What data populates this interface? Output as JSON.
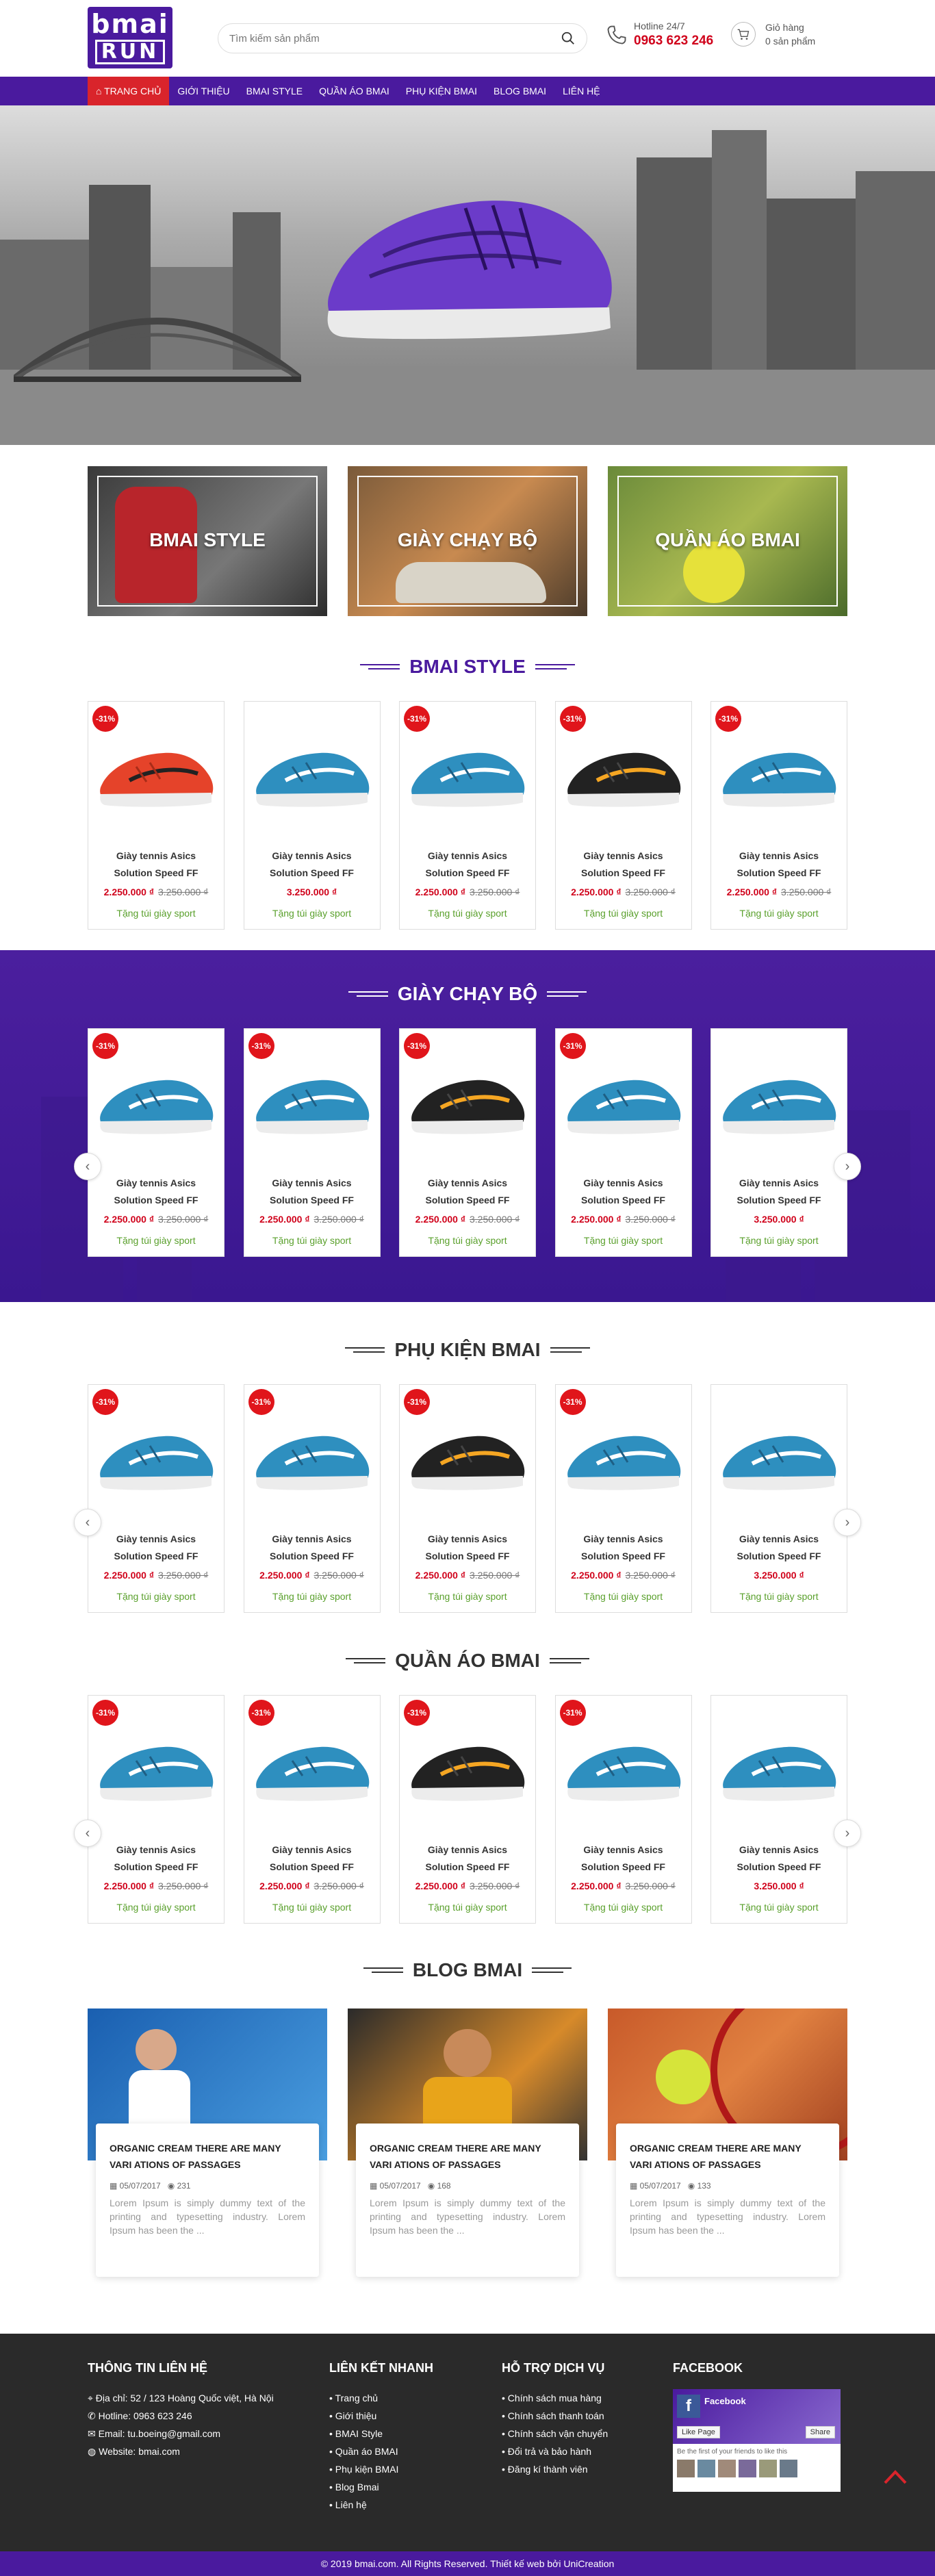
{
  "header": {
    "logo_top": "bmai",
    "logo_bottom": "RUN",
    "search_placeholder": "Tìm kiếm sản phẩm",
    "hotline_label": "Hotline 24/7",
    "hotline_number": "0963 623 246",
    "cart_label": "Giỏ hàng",
    "cart_count": "0 sản phẩm"
  },
  "nav": [
    "Trang chủ",
    "Giới thiệu",
    "BMAI Style",
    "Quần áo BMAI",
    "Phụ kiện BMAI",
    "Blog BMAI",
    "Liên hệ"
  ],
  "categories": [
    "BMAI STYLE",
    "GIÀY CHẠY BỘ",
    "QUẦN ÁO BMAI"
  ],
  "sections": [
    {
      "title": "BMAI STYLE",
      "products": [
        {
          "disc": "-31%",
          "name": "Giày tennis Asics Solution Speed FF",
          "price": "2.250.000 ₫",
          "old": "3.250.000 ₫",
          "gift": "Tặng túi giày sport",
          "color": "red"
        },
        {
          "disc": "",
          "name": "Giày tennis Asics Solution Speed FF",
          "price": "3.250.000 ₫",
          "old": "",
          "gift": "Tặng túi giày sport",
          "color": "blue"
        },
        {
          "disc": "-31%",
          "name": "Giày tennis Asics Solution Speed FF",
          "price": "2.250.000 ₫",
          "old": "3.250.000 ₫",
          "gift": "Tặng túi giày sport",
          "color": "blue"
        },
        {
          "disc": "-31%",
          "name": "Giày tennis Asics Solution Speed FF",
          "price": "2.250.000 ₫",
          "old": "3.250.000 ₫",
          "gift": "Tặng túi giày sport",
          "color": "black"
        },
        {
          "disc": "-31%",
          "name": "Giày tennis Asics Solution Speed FF",
          "price": "2.250.000 ₫",
          "old": "3.250.000 ₫",
          "gift": "Tặng túi giày sport",
          "color": "blue"
        }
      ]
    },
    {
      "title": "GIÀY CHẠY BỘ",
      "products": [
        {
          "disc": "-31%",
          "name": "Giày tennis Asics Solution Speed FF",
          "price": "2.250.000 ₫",
          "old": "3.250.000 ₫",
          "gift": "Tặng túi giày sport",
          "color": "blue"
        },
        {
          "disc": "-31%",
          "name": "Giày tennis Asics Solution Speed FF",
          "price": "2.250.000 ₫",
          "old": "3.250.000 ₫",
          "gift": "Tặng túi giày sport",
          "color": "blue"
        },
        {
          "disc": "-31%",
          "name": "Giày tennis Asics Solution Speed FF",
          "price": "2.250.000 ₫",
          "old": "3.250.000 ₫",
          "gift": "Tặng túi giày sport",
          "color": "black"
        },
        {
          "disc": "-31%",
          "name": "Giày tennis Asics Solution Speed FF",
          "price": "2.250.000 ₫",
          "old": "3.250.000 ₫",
          "gift": "Tặng túi giày sport",
          "color": "blue"
        },
        {
          "disc": "",
          "name": "Giày tennis Asics Solution Speed FF",
          "price": "3.250.000 ₫",
          "old": "",
          "gift": "Tặng túi giày sport",
          "color": "blue"
        }
      ]
    },
    {
      "title": "PHỤ KIỆN BMAI",
      "products": [
        {
          "disc": "-31%",
          "name": "Giày tennis Asics Solution Speed FF",
          "price": "2.250.000 ₫",
          "old": "3.250.000 ₫",
          "gift": "Tặng túi giày sport",
          "color": "blue"
        },
        {
          "disc": "-31%",
          "name": "Giày tennis Asics Solution Speed FF",
          "price": "2.250.000 ₫",
          "old": "3.250.000 ₫",
          "gift": "Tặng túi giày sport",
          "color": "blue"
        },
        {
          "disc": "-31%",
          "name": "Giày tennis Asics Solution Speed FF",
          "price": "2.250.000 ₫",
          "old": "3.250.000 ₫",
          "gift": "Tặng túi giày sport",
          "color": "black"
        },
        {
          "disc": "-31%",
          "name": "Giày tennis Asics Solution Speed FF",
          "price": "2.250.000 ₫",
          "old": "3.250.000 ₫",
          "gift": "Tặng túi giày sport",
          "color": "blue"
        },
        {
          "disc": "",
          "name": "Giày tennis Asics Solution Speed FF",
          "price": "3.250.000 ₫",
          "old": "",
          "gift": "Tặng túi giày sport",
          "color": "blue"
        }
      ]
    },
    {
      "title": "QUẦN ÁO BMAI",
      "products": [
        {
          "disc": "-31%",
          "name": "Giày tennis Asics Solution Speed FF",
          "price": "2.250.000 ₫",
          "old": "3.250.000 ₫",
          "gift": "Tặng túi giày sport",
          "color": "blue"
        },
        {
          "disc": "-31%",
          "name": "Giày tennis Asics Solution Speed FF",
          "price": "2.250.000 ₫",
          "old": "3.250.000 ₫",
          "gift": "Tặng túi giày sport",
          "color": "blue"
        },
        {
          "disc": "-31%",
          "name": "Giày tennis Asics Solution Speed FF",
          "price": "2.250.000 ₫",
          "old": "3.250.000 ₫",
          "gift": "Tặng túi giày sport",
          "color": "black"
        },
        {
          "disc": "-31%",
          "name": "Giày tennis Asics Solution Speed FF",
          "price": "2.250.000 ₫",
          "old": "3.250.000 ₫",
          "gift": "Tặng túi giày sport",
          "color": "blue"
        },
        {
          "disc": "",
          "name": "Giày tennis Asics Solution Speed FF",
          "price": "3.250.000 ₫",
          "old": "",
          "gift": "Tặng túi giày sport",
          "color": "blue"
        }
      ]
    }
  ],
  "blog": {
    "title": "BLOG BMAI",
    "posts": [
      {
        "title": "ORGANIC CREAM THERE ARE MANY VARI ATIONS OF PASSAGES",
        "date": "05/07/2017",
        "views": "231",
        "excerpt": "Lorem Ipsum is simply dummy text of the printing and typesetting industry. Lorem Ipsum has been the ..."
      },
      {
        "title": "ORGANIC CREAM THERE ARE MANY VARI ATIONS OF PASSAGES",
        "date": "05/07/2017",
        "views": "168",
        "excerpt": "Lorem Ipsum is simply dummy text of the printing and typesetting industry. Lorem Ipsum has been the ..."
      },
      {
        "title": "ORGANIC CREAM THERE ARE MANY VARI ATIONS OF PASSAGES",
        "date": "05/07/2017",
        "views": "133",
        "excerpt": "Lorem Ipsum is simply dummy text of the printing and typesetting industry. Lorem Ipsum has been the ..."
      }
    ]
  },
  "footer": {
    "contact_title": "THÔNG TIN LIÊN HỆ",
    "contact": [
      "Địa chỉ: 52 / 123 Hoàng Quốc việt, Hà Nội",
      "Hotline: 0963 623 246",
      "Email: tu.boeing@gmail.com",
      "Website: bmai.com"
    ],
    "links_title": "LIÊN KẾT NHANH",
    "links": [
      "Trang chủ",
      "Giới thiệu",
      "BMAI Style",
      "Quần áo BMAI",
      "Phụ kiện BMAI",
      "Blog Bmai",
      "Liên hệ"
    ],
    "support_title": "HỖ TRỢ DỊCH VỤ",
    "support": [
      "Chính sách mua hàng",
      "Chính sách thanh toán",
      "Chính sách vận chuyển",
      "Đổi trả và bảo hành",
      "Đăng kí thành viên"
    ],
    "fb_title": "FACEBOOK",
    "fb_name": "Facebook",
    "fb_like": "Like Page",
    "fb_share": "Share",
    "fb_text": "Be the first of your friends to like this",
    "copyright": "© 2019 bmai.com. All Rights Reserved. Thiết kế web bởi UniCreation"
  },
  "colors": {
    "brand": "#4a1a9e",
    "red": "#d0021b",
    "green": "#5aa02c"
  }
}
